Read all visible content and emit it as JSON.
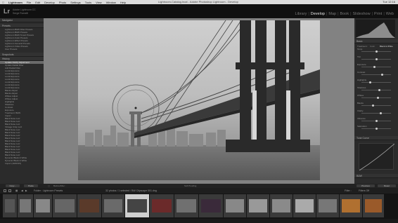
{
  "menubar": {
    "items": [
      "Lightroom",
      "File",
      "Edit",
      "Develop",
      "Photo",
      "Settings",
      "Tools",
      "View",
      "Window",
      "Help"
    ],
    "window_title": "Lightroom-Catalog.lrcat - Adobe Photoshop Lightroom - Develop",
    "clock": "Tue 12:16"
  },
  "identity": {
    "logo": "Lr",
    "line1": "Adobe Lightroom CC",
    "line2": "Serge Ramelli"
  },
  "modules": [
    "Library",
    "Develop",
    "Map",
    "Book",
    "Slideshow",
    "Print",
    "Web"
  ],
  "active_module": "Develop",
  "left_panel": {
    "navigator_label": "Navigator",
    "presets_label": "Presets",
    "snapshots_label": "Snapshots",
    "history_label": "History",
    "collections_label": "Collections",
    "presets": [
      "Lightroom B&W Filter Presets",
      "Lightroom B&W Presets",
      "Lightroom B&W Toned Presets",
      "Lightroom Color Presets",
      "Lightroom Effect Presets",
      "Lightroom General Presets",
      "Lightroom Video Presets",
      "User Presets"
    ],
    "history": [
      "Update Clarity Adjustment",
      "Update Radial Filter",
      "Add Radial Filter",
      "Local Exposure",
      "Local Exposure",
      "Local Exposure",
      "Local Exposure",
      "Local Exposure",
      "Local Exposure",
      "Local Exposure",
      "Blacks Adjust",
      "Blacks Adjust",
      "Whites Adjust",
      "Whites Adjust",
      "Highlights",
      "Shadows",
      "Contrast",
      "Exposure",
      "Treatment: B&W",
      "Import",
      "Black Nose Luiz",
      "Black Nose Luiz",
      "Black Nose Luiz",
      "Vintage Crisp Luiz",
      "Black Nose Luiz",
      "Black Nose Luiz",
      "Black Nose Luiz",
      "Black Nose Luiz",
      "Black Nose Luiz",
      "Black Nose Luiz",
      "Black Nose Luiz",
      "Black Nose Luiz",
      "Black Nose Luiz",
      "Black Nose Luiz",
      "Dynamic Black & White",
      "Dynamic Black & White",
      "Import (10/20/15)"
    ],
    "copy_button": "Copy...",
    "paste_button": "Paste"
  },
  "toolbar": {
    "before_after": "Before/After :",
    "soft_proof": "Soft Proofing"
  },
  "right_panel": {
    "histogram_label": "Histogram",
    "basic_label": "Basic",
    "treatment_label": "Treatment :",
    "treatment_color": "Color",
    "treatment_bw": "Black & White",
    "tone_curve_label": "Tone Curve",
    "hsl_label": "B&W",
    "previous_button": "Previous",
    "reset_button": "Reset",
    "sliders": [
      "Temp",
      "Tint",
      "Exposure",
      "Contrast",
      "Highlights",
      "Shadows",
      "Whites",
      "Blacks",
      "Clarity",
      "Vibrance",
      "Saturation"
    ],
    "slider_levels": [
      0.5,
      0.5,
      0.45,
      0.7,
      0.3,
      0.6,
      0.55,
      0.4,
      0.65,
      0.5,
      0.5
    ]
  },
  "filmstrip": {
    "source_label": "Folder : Lightroom Presets",
    "count_label": "32 photos / 1 selected / BW Cityscape 001.dng",
    "filter_label": "Filter :",
    "filter_value": "Filters Off",
    "selected_index": 6
  },
  "colors": {
    "app_bg": "#1b1b1b",
    "panel_bg": "#2b2b2b",
    "canvas_bg": "#828282",
    "highlight": "#6b6b6b",
    "text": "#c8c8c8"
  }
}
